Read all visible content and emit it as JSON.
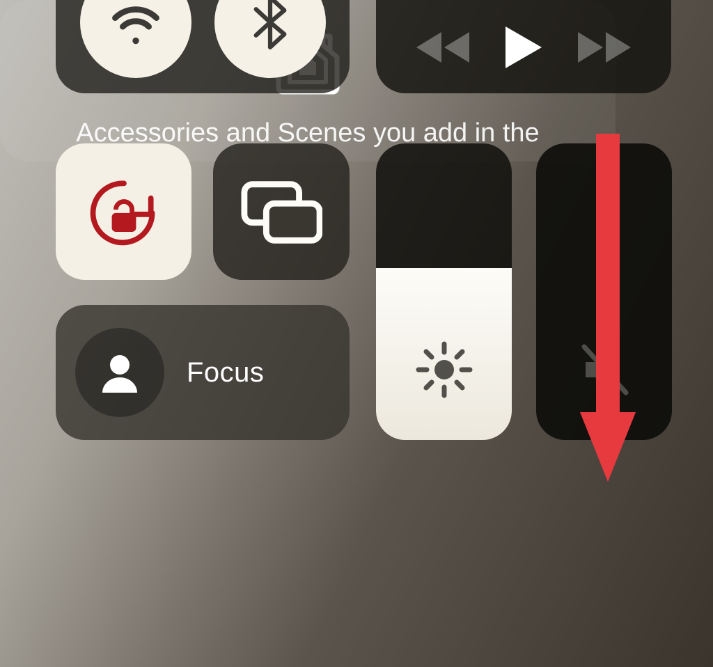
{
  "connectivity": {
    "wifi_on": true,
    "bluetooth_on": true
  },
  "media": {
    "state": "paused"
  },
  "controls": {
    "orientation_lock_on": true,
    "screen_mirroring_label": "Screen Mirroring",
    "focus_label": "Focus",
    "brightness_percent": 58,
    "volume_percent": 0,
    "volume_muted": true
  },
  "home": {
    "hint_text": "Accessories and Scenes you add in the"
  },
  "annotation": {
    "type": "arrow",
    "color": "#e63a3f"
  }
}
